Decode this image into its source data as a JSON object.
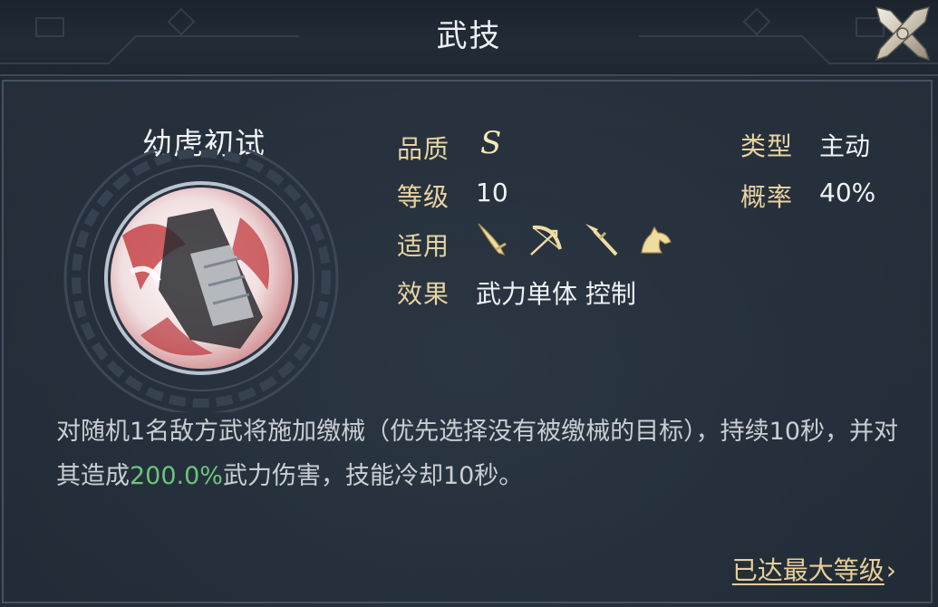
{
  "header": {
    "title": "武技"
  },
  "skill": {
    "name": "幼虎初试",
    "labels": {
      "quality": "品质",
      "level": "等级",
      "applies": "适用",
      "effect": "效果",
      "type": "类型",
      "chance": "概率"
    },
    "values": {
      "quality": "S",
      "level": "10",
      "effect": "武力单体 控制",
      "type": "主动",
      "chance": "40%"
    },
    "applicable_units": [
      "blade-icon",
      "bow-icon",
      "spear-icon",
      "horse-icon"
    ]
  },
  "description": {
    "part1": "对随机1名敌方武将施加缴械（优先选择没有被缴械的目标），持续10秒，并对其造成",
    "highlight": "200.0%",
    "part2": "武力伤害，技能冷却10秒。"
  },
  "footer": {
    "max_level_label": "已达最大等级",
    "arrow": "›"
  },
  "colors": {
    "label": "#e8d3a0",
    "highlight": "#6cc57a",
    "quality": "#f5e9b6"
  }
}
